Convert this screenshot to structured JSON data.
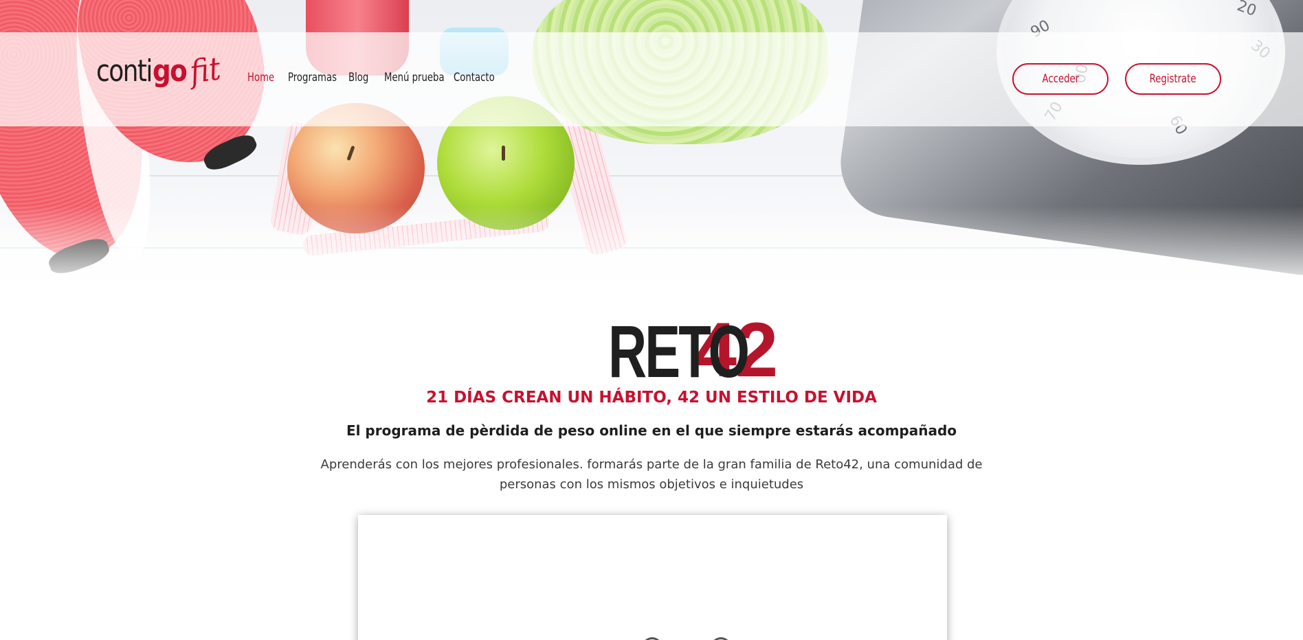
{
  "header": {
    "logo": {
      "part1": "conti",
      "part2": "go",
      "part3": "fit"
    },
    "nav": [
      {
        "label": "Home",
        "active": true
      },
      {
        "label": "Programas",
        "active": false
      },
      {
        "label": "Blog",
        "active": false
      },
      {
        "label": "Menú prueba",
        "active": false
      },
      {
        "label": "Contacto",
        "active": false
      }
    ],
    "login_label": "Acceder",
    "register_label": "Registrate"
  },
  "hero": {
    "scale_numbers": [
      "90",
      "20",
      "30",
      "70",
      "00",
      "60"
    ]
  },
  "main": {
    "brand": {
      "word": "RETO",
      "number": "42"
    },
    "tagline": "21 DÍAS CREAN UN HÁBITO, 42 UN ESTILO DE VIDA",
    "headline": "El programa de pèrdida de peso online en el que siempre estarás acompañado",
    "description": "Aprenderás con los mejores profesionales. formarás parte de la gran familia de Reto42, una comunidad de personas con los mismos objetivos e inquietudes"
  },
  "colors": {
    "accent": "#c8102e",
    "brand_number": "#b5152b",
    "text_dark": "#1e1e1e"
  }
}
